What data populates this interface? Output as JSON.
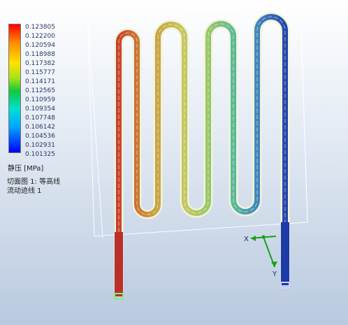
{
  "legend": {
    "ticks": [
      "0.123805",
      "0.122200",
      "0.120594",
      "0.118988",
      "0.117382",
      "0.115777",
      "0.114171",
      "0.112565",
      "0.110959",
      "0.109354",
      "0.107748",
      "0.106142",
      "0.104536",
      "0.102931",
      "0.101325"
    ],
    "unit_label": "静压 [MPa]",
    "colors": [
      "#ff0000",
      "#ff8a00",
      "#ffe100",
      "#a8e21a",
      "#13c83a",
      "#00e0d0",
      "#00a6ff",
      "#0000ff"
    ]
  },
  "info": {
    "line1": "切面图 1: 等高线",
    "line2": "流动迹线 1"
  },
  "axes": {
    "x_label": "X",
    "y_label": "Y"
  }
}
